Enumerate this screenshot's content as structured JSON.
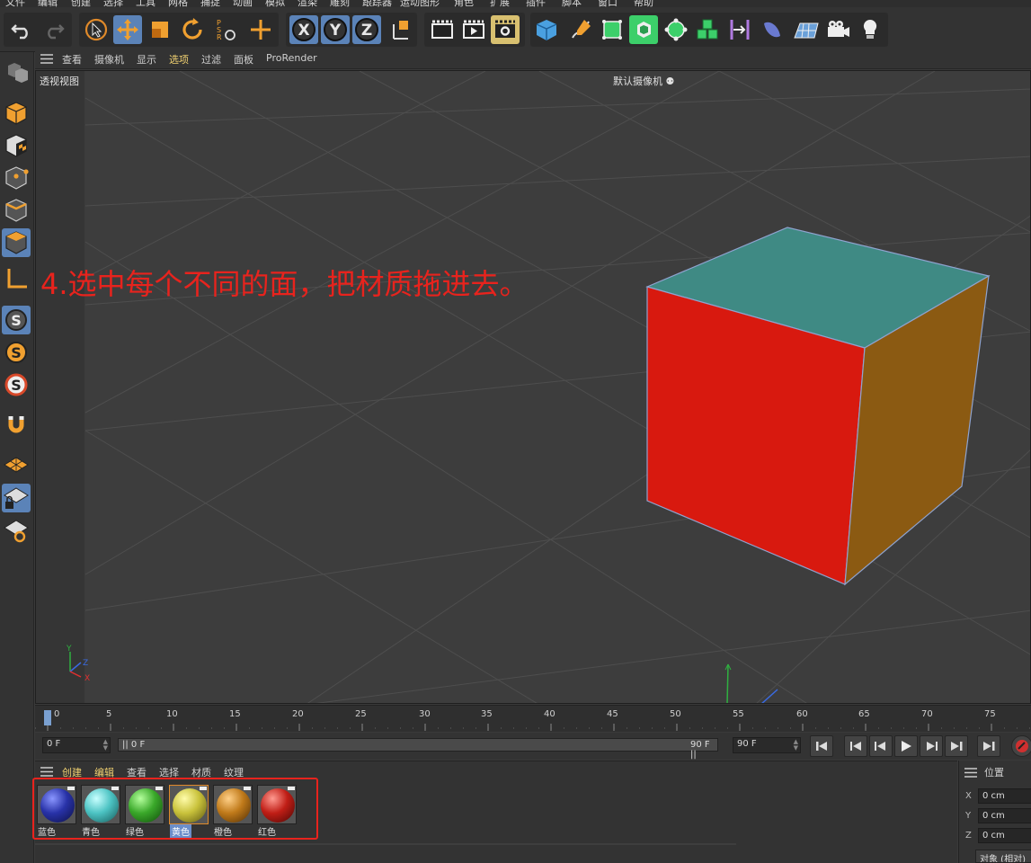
{
  "menubar": {
    "items": [
      "文件",
      "编辑",
      "创建",
      "选择",
      "工具",
      "网格",
      "捕捉",
      "动画",
      "模拟",
      "渲染",
      "雕刻",
      "跟踪器",
      "运动图形",
      "角色",
      "扩展",
      "插件",
      "脚本",
      "窗口",
      "帮助"
    ]
  },
  "toolbar": {
    "undo": "undo-icon",
    "redo": "redo-icon",
    "axis_x": "X",
    "axis_y": "Y",
    "axis_z": "Z"
  },
  "viewport_menu": {
    "items": [
      "查看",
      "摄像机",
      "显示",
      "选项",
      "过滤",
      "面板",
      "ProRender"
    ],
    "active_index": 3
  },
  "viewport": {
    "view_label": "透视视图",
    "camera_label": "默认摄像机",
    "instruction": "4.选中每个不同的面，把材质拖进去。",
    "instruction_color": "#e8231d",
    "axis_labels": {
      "x": "X",
      "y": "Y",
      "z": "Z"
    },
    "cube_colors": {
      "front": "#d8190f",
      "top": "#3f8a84",
      "right": "#8b5a12"
    }
  },
  "timeline": {
    "ticks": [
      "0",
      "5",
      "10",
      "15",
      "20",
      "25",
      "30",
      "35",
      "40",
      "45",
      "50",
      "55",
      "60",
      "65",
      "70",
      "75"
    ]
  },
  "transport": {
    "current_frame": "0 F",
    "range_start": "0 F",
    "range_end": "90 F",
    "end_frame": "90 F"
  },
  "material_manager": {
    "menu": [
      "创建",
      "编辑",
      "查看",
      "选择",
      "材质",
      "纹理"
    ],
    "materials": [
      {
        "name": "蓝色",
        "color": "#2832a8",
        "selected": false
      },
      {
        "name": "青色",
        "color": "#4cc3c3",
        "selected": false
      },
      {
        "name": "绿色",
        "color": "#3aa82a",
        "selected": false
      },
      {
        "name": "黄色",
        "color": "#c9c23b",
        "selected": true
      },
      {
        "name": "橙色",
        "color": "#c07a1a",
        "selected": false
      },
      {
        "name": "红色",
        "color": "#c01e16",
        "selected": false
      }
    ]
  },
  "attributes": {
    "title": "位置",
    "x": "0 cm",
    "y": "0 cm",
    "z": "0 cm",
    "mode": "对象 (相对)"
  }
}
